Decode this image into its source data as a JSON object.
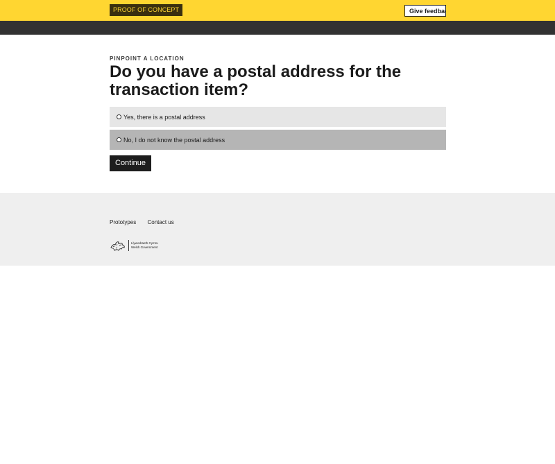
{
  "header": {
    "badge_label": "PROOF OF CONCEPT",
    "feedback_label": "Give feedback"
  },
  "page": {
    "caption": "PINPOINT A LOCATION",
    "heading": "Do you have a postal address for the transaction item?"
  },
  "options": [
    {
      "label": "Yes, there is a postal address"
    },
    {
      "label": "No, I do not know the postal address"
    }
  ],
  "actions": {
    "continue_label": "Continue"
  },
  "footer": {
    "links": [
      "Prototypes",
      "Contact us"
    ],
    "logo_line_1": "Llywodraeth Cymru",
    "logo_line_2": "Welsh Government"
  },
  "icons": {
    "logo": "dragon-icon",
    "radio": "radio-icon"
  },
  "colors": {
    "topbar": "#ffd631",
    "badge": "#3a2f0f",
    "darkbar": "#323232",
    "button": "#1d1d1d",
    "footer": "#efefef"
  }
}
